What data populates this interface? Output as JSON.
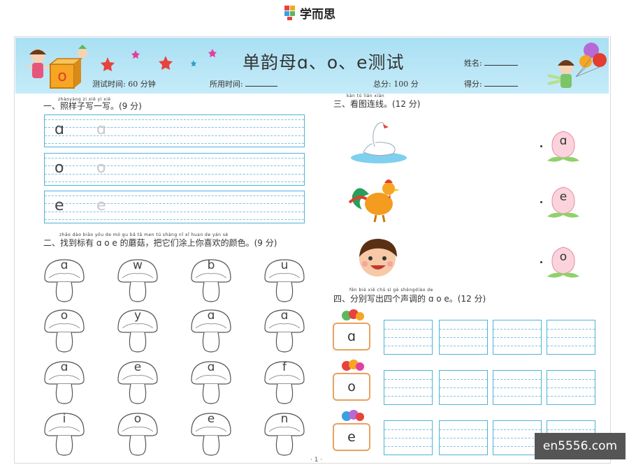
{
  "brand": {
    "name": "学而思"
  },
  "header": {
    "title": "单韵母ɑ、o、e测试",
    "name_label": "姓名:",
    "time_label": "测试时间: 60 分钟",
    "used_time_label": "所用时间:",
    "total_label": "总分: 100 分",
    "score_label": "得分:",
    "cube_letter": "o"
  },
  "section1": {
    "title": "一、照样子写一写。(9 分)",
    "pinyin": "zhàoyàng zi xiě yì xiě",
    "rows": [
      {
        "example": "ɑ",
        "trace": "ɑ"
      },
      {
        "example": "o",
        "trace": "o"
      },
      {
        "example": "e",
        "trace": "e"
      }
    ]
  },
  "section2": {
    "title": "二、找到标有 ɑ o e 的蘑菇，把它们涂上你喜欢的颜色。(9 分)",
    "pinyin": "zhǎo dào biāo yǒu        de mó gu   bǎ tā men tú shàng nǐ  xǐ huan de yán sè",
    "mushrooms": [
      "ɑ",
      "w",
      "b",
      "u",
      "o",
      "y",
      "ɑ",
      "ɑ",
      "ɑ",
      "e",
      "ɑ",
      "f",
      "i",
      "o",
      "e",
      "n"
    ]
  },
  "section3": {
    "title": "三、看图连线。(12 分)",
    "pinyin": "kàn tú lián xiàn",
    "pictures": [
      "swan-picture",
      "rooster-picture",
      "child-face-picture"
    ],
    "peaches": [
      "ɑ",
      "e",
      "o"
    ]
  },
  "section4": {
    "title": "四、分别写出四个声调的 ɑ o e。(12 分)",
    "pinyin": "fēn bié xiě chū sì  gè shēngdiào de",
    "vowels": [
      "ɑ",
      "o",
      "e"
    ]
  },
  "footer": {
    "page": "· 1 ·"
  },
  "watermark": "en5556.com",
  "colors": {
    "header_bg": "#b8e5f5",
    "grid_line": "#4fb2d7",
    "vowel_border": "#e9a160"
  }
}
